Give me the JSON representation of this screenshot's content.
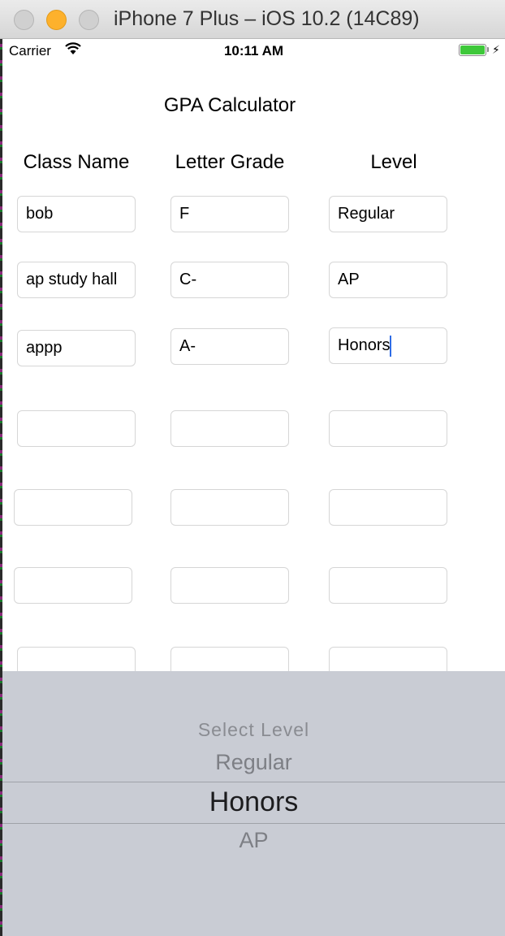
{
  "window": {
    "title": "iPhone 7 Plus – iOS 10.2 (14C89)"
  },
  "status_bar": {
    "carrier": "Carrier",
    "time": "10:11 AM"
  },
  "app": {
    "title": "GPA Calculator",
    "headers": {
      "class_name": "Class Name",
      "letter_grade": "Letter Grade",
      "level": "Level"
    },
    "rows": [
      {
        "class_name": "bob",
        "letter_grade": "F",
        "level": "Regular"
      },
      {
        "class_name": "ap study hall",
        "letter_grade": "C-",
        "level": "AP"
      },
      {
        "class_name": "appp",
        "letter_grade": "A-",
        "level": "Honors"
      },
      {
        "class_name": "",
        "letter_grade": "",
        "level": ""
      },
      {
        "class_name": "",
        "letter_grade": "",
        "level": ""
      },
      {
        "class_name": "",
        "letter_grade": "",
        "level": ""
      },
      {
        "class_name": "",
        "letter_grade": "",
        "level": ""
      }
    ]
  },
  "picker": {
    "options": [
      "Select Level",
      "Regular",
      "Honors",
      "AP"
    ],
    "selected": "Honors"
  },
  "colors": {
    "caret": "#2e6ce6",
    "picker_background": "#c9ccd4",
    "battery": "#3ec83a"
  }
}
